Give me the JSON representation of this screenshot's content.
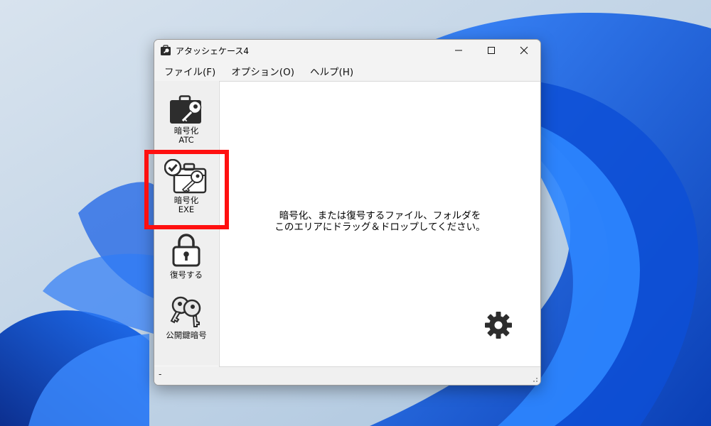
{
  "window": {
    "title": "アタッシェケース4"
  },
  "menu": {
    "items": [
      "ファイル(F)",
      "オプション(O)",
      "ヘルプ(H)"
    ]
  },
  "sidebar": {
    "encrypt_atc": {
      "line1": "暗号化",
      "line2": "ATC",
      "icon": "briefcase-key-icon"
    },
    "encrypt_exe": {
      "line1": "暗号化",
      "line2": "EXE",
      "icon": "briefcase-check-key-icon"
    },
    "decrypt": {
      "label": "復号する",
      "icon": "padlock-icon"
    },
    "public_key": {
      "label": "公開鍵暗号",
      "icon": "keys-icon"
    }
  },
  "drop_area": {
    "line1": "暗号化、または復号するファイル、フォルダを",
    "line2": "このエリアにドラッグ＆ドロップしてください。",
    "settings_icon": "gear-icon"
  },
  "status_bar": {
    "text": "-"
  },
  "colors": {
    "highlight": "#ff1010",
    "wallpaper_blue": "#1a5fe6"
  }
}
